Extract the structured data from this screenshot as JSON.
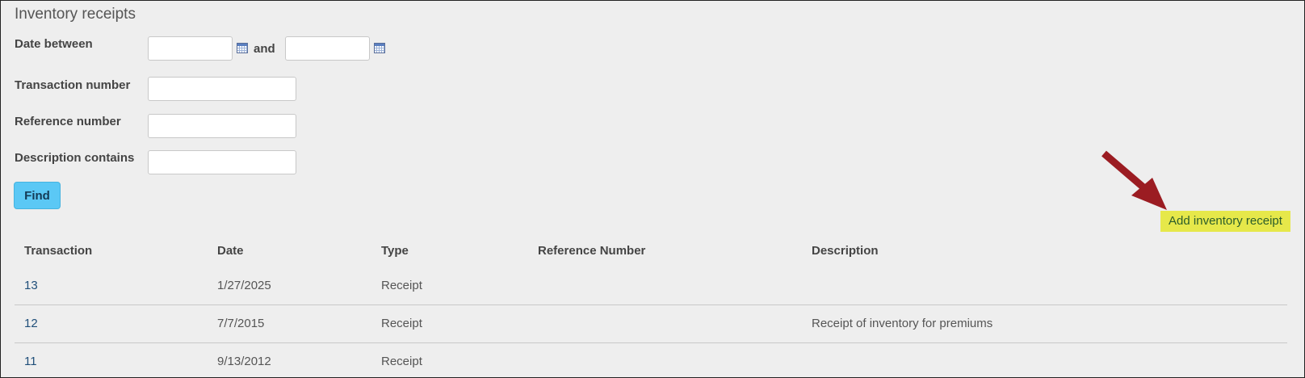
{
  "page": {
    "title": "Inventory receipts"
  },
  "filters": {
    "date_between_label": "Date between",
    "and_label": "and",
    "date_from_value": "",
    "date_to_value": "",
    "transaction_number_label": "Transaction number",
    "transaction_number_value": "",
    "reference_number_label": "Reference number",
    "reference_number_value": "",
    "description_contains_label": "Description contains",
    "description_contains_value": "",
    "find_label": "Find"
  },
  "actions": {
    "add_inventory_receipt_label": "Add inventory receipt",
    "highlight_color": "#e6e84a",
    "arrow_color": "#9b1c22"
  },
  "table": {
    "columns": [
      "Transaction",
      "Date",
      "Type",
      "Reference Number",
      "Description"
    ],
    "rows": [
      {
        "transaction": "13",
        "date": "1/27/2025",
        "type": "Receipt",
        "reference": "",
        "description": ""
      },
      {
        "transaction": "12",
        "date": "7/7/2015",
        "type": "Receipt",
        "reference": "",
        "description": "Receipt of inventory for premiums"
      },
      {
        "transaction": "11",
        "date": "9/13/2012",
        "type": "Receipt",
        "reference": "",
        "description": ""
      }
    ]
  },
  "icons": {
    "calendar": "calendar-icon",
    "arrow": "arrow-icon"
  }
}
